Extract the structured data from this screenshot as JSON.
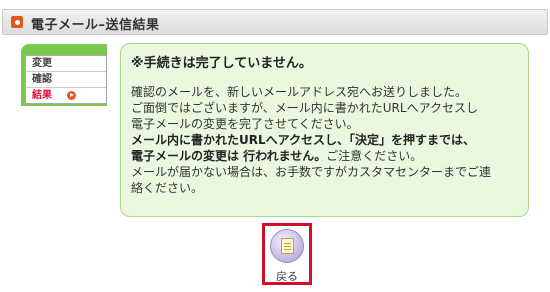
{
  "header": {
    "title": "電子メール–送信結果",
    "icon": "orange-square-bullet-icon"
  },
  "steps": {
    "items": [
      {
        "label": "変更",
        "active": false
      },
      {
        "label": "確認",
        "active": false
      },
      {
        "label": "結果",
        "active": true
      }
    ],
    "active_marker_icon": "orange-arrow-circle-icon"
  },
  "message": {
    "heading": "※手続きは完了していません。",
    "lines": [
      {
        "text": "確認のメールを、新しいメールアドレス宛へお送りしました。"
      },
      {
        "text": "ご面倒ではございますが、メール内に書かれたURLへアクセスし"
      },
      {
        "text": "電子メールの変更を完了させてください。"
      },
      {
        "bold": "メール内に書かれたURLへアクセスし、「決定」を押すまでは、"
      },
      {
        "bold": "電子メールの変更は 行われません。",
        "text": "ご注意ください。"
      },
      {
        "text": "メールが届かない場合は、お手数ですがカスタマセンターまでご連"
      },
      {
        "text": "絡ください。"
      }
    ]
  },
  "back_button": {
    "label": "戻る",
    "icon": "document-icon"
  },
  "colors": {
    "accent_green": "#7cc84f",
    "message_bg": "#ebf8e0",
    "highlight_red": "#d0102a",
    "bullet_orange": "#e8561f"
  }
}
